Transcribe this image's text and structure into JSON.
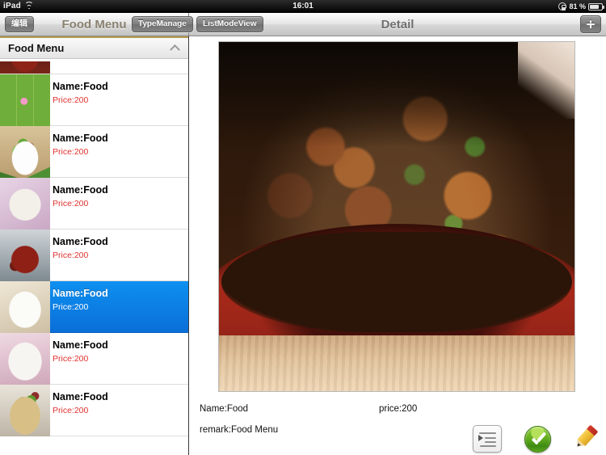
{
  "status_bar": {
    "carrier": "iPad",
    "wifi_icon": "wifi-icon",
    "time": "16:01",
    "rotation_lock_icon": "rotation-lock-icon",
    "battery_percent": "81 %",
    "battery_icon": "battery-icon"
  },
  "left_nav": {
    "edit_button": "编辑",
    "title": "Food Menu",
    "type_manage_button": "TypeManage"
  },
  "right_nav": {
    "list_mode_button": "ListModeView",
    "title": "Detail",
    "add_button_icon": "plus-icon"
  },
  "sidebar": {
    "section_title": "Food Menu",
    "collapse_icon": "chevron-up-icon",
    "rows": [
      {
        "name": "Name:Food",
        "price": "Price:200",
        "thumb": "t-collage",
        "selected": false
      },
      {
        "name": "Name:Food",
        "price": "Price:200",
        "thumb": "t-greens",
        "selected": false
      },
      {
        "name": "Name:Food",
        "price": "Price:200",
        "thumb": "t-potato",
        "selected": false
      },
      {
        "name": "Name:Food",
        "price": "Price:200",
        "thumb": "t-chili",
        "selected": false
      },
      {
        "name": "Name:Food",
        "price": "Price:200",
        "thumb": "t-noodle",
        "selected": true
      },
      {
        "name": "Name:Food",
        "price": "Price:200",
        "thumb": "t-braise",
        "selected": false
      },
      {
        "name": "Name:Food",
        "price": "Price:200",
        "thumb": "t-rice",
        "selected": false
      }
    ]
  },
  "detail": {
    "photo_alt": "braised-chicken-in-red-pot-photo",
    "name": "Name:Food",
    "price": "price:200",
    "remark": "remark:Food Menu",
    "actions": {
      "list_icon": "list-indent-icon",
      "confirm_icon": "green-check-icon",
      "edit_icon": "pencil-edit-icon"
    }
  },
  "colors": {
    "selection_blue": "#0e90f0",
    "price_red": "#e0322e",
    "section_rule_gold": "#b59a4e",
    "confirm_green": "#63ad1f"
  }
}
